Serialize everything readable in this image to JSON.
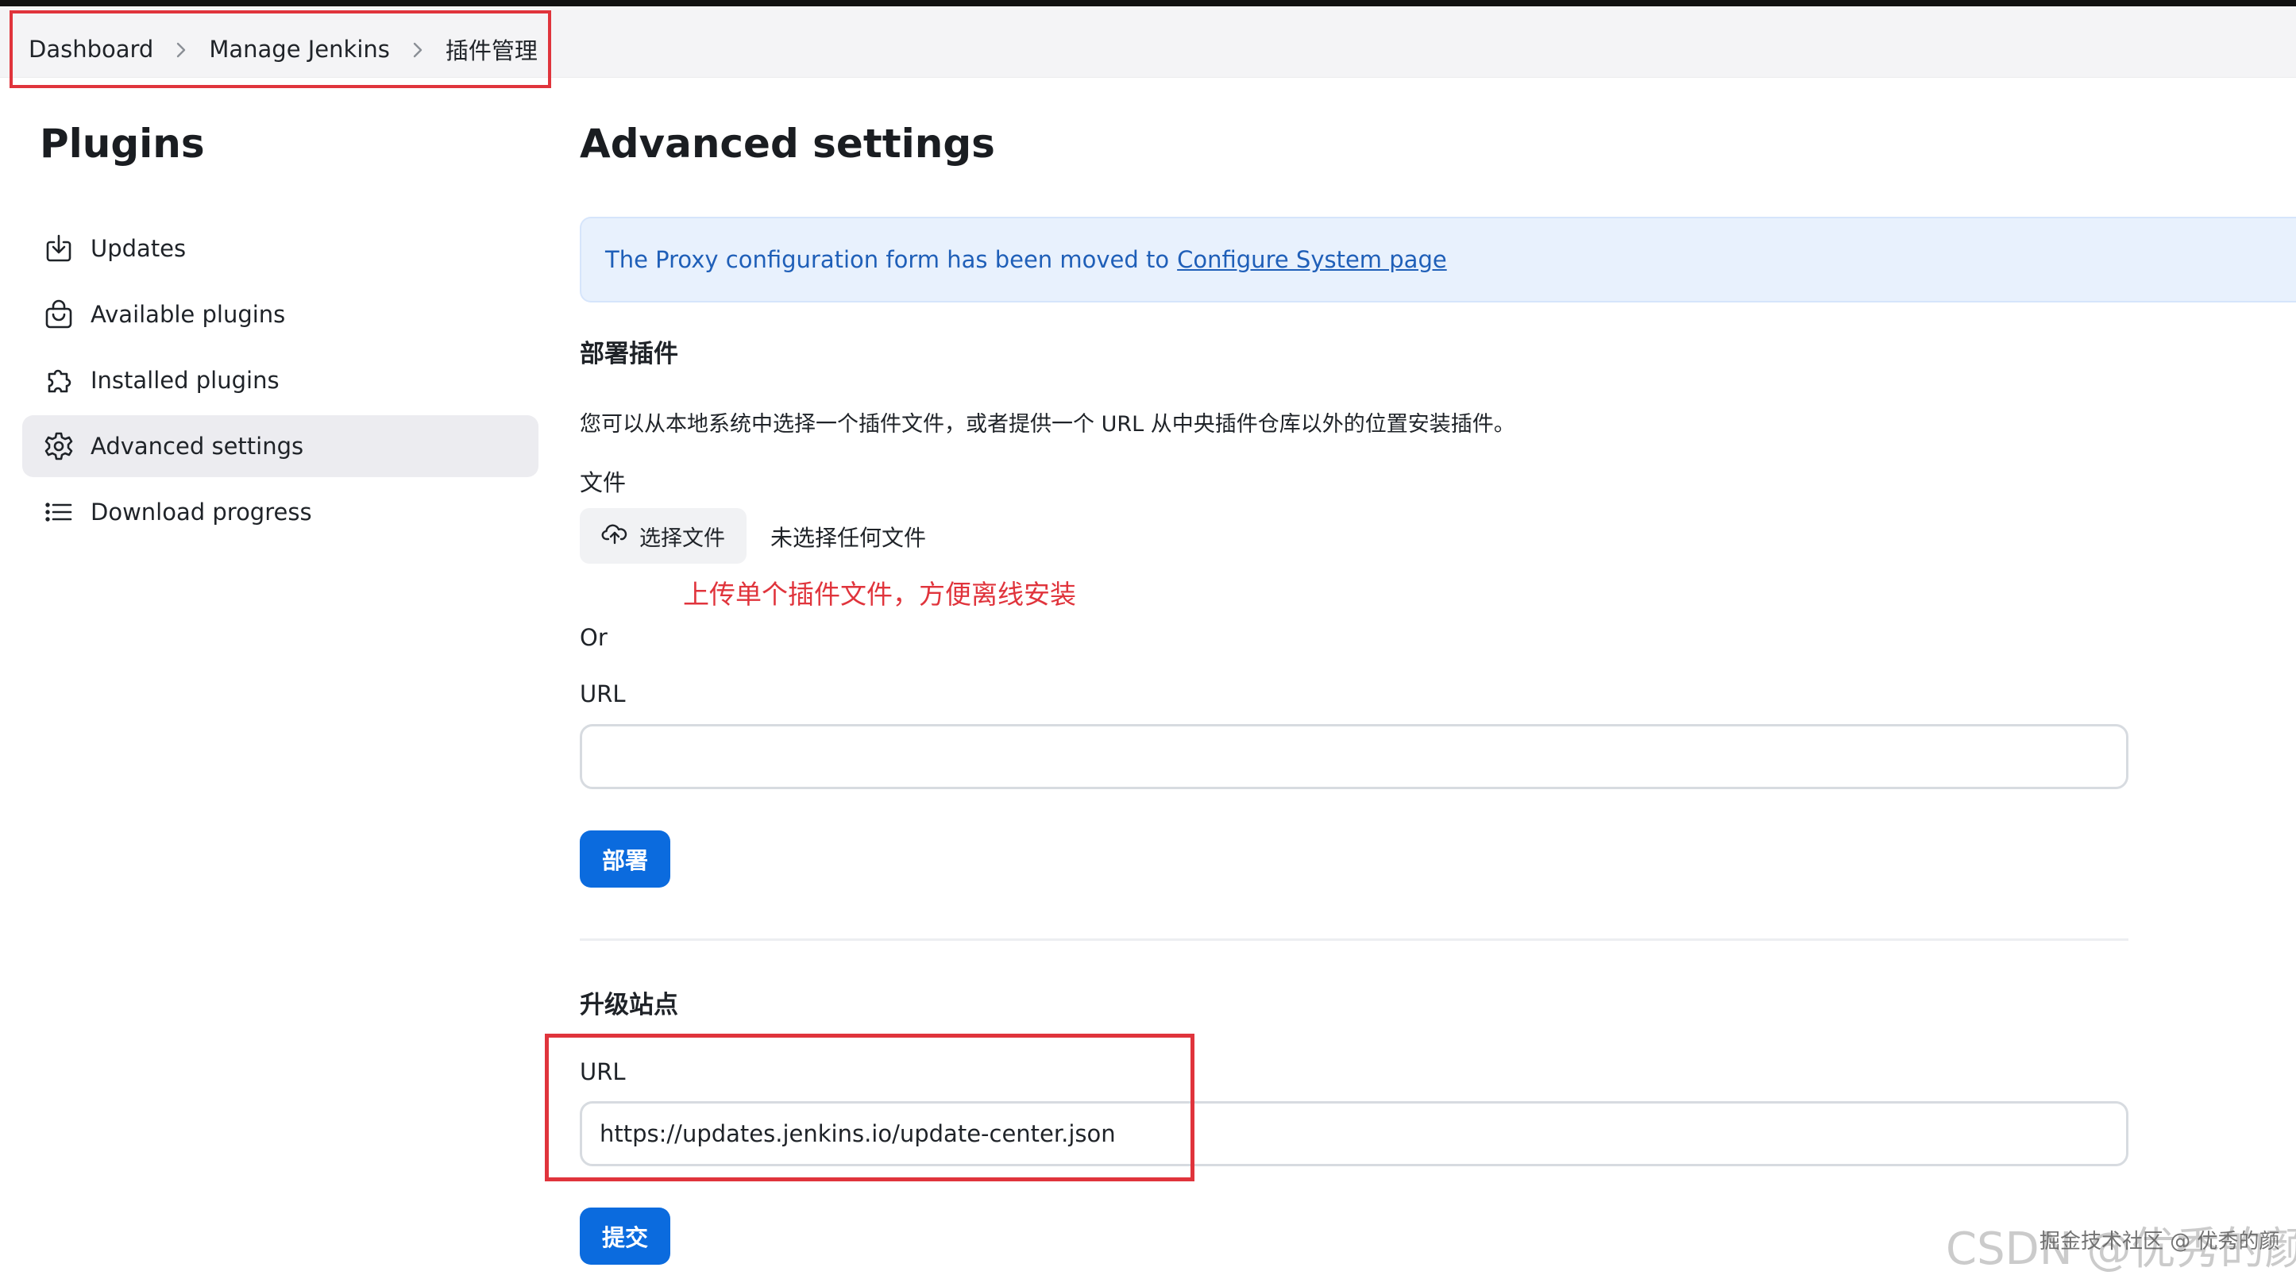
{
  "breadcrumb": {
    "items": [
      "Dashboard",
      "Manage Jenkins",
      "插件管理"
    ]
  },
  "sidebar": {
    "title": "Plugins",
    "items": [
      {
        "label": "Updates",
        "icon": "download-icon"
      },
      {
        "label": "Available plugins",
        "icon": "shopping-bag-icon"
      },
      {
        "label": "Installed plugins",
        "icon": "puzzle-icon"
      },
      {
        "label": "Advanced settings",
        "icon": "gear-icon",
        "active": true
      },
      {
        "label": "Download progress",
        "icon": "list-icon"
      }
    ]
  },
  "main": {
    "title": "Advanced settings",
    "notice": {
      "text": "The Proxy configuration form has been moved to",
      "link": "Configure System page",
      "color": "#1f5fb8"
    },
    "deploy": {
      "section_title": "部署插件",
      "description": "您可以从本地系统中选择一个插件文件，或者提供一个 URL 从中央插件仓库以外的位置安装插件。",
      "file_label": "文件",
      "choose_file_button": "选择文件",
      "no_file_text": "未选择任何文件",
      "annotation": "上传单个插件文件，方便离线安装",
      "or_text": "Or",
      "url_label": "URL",
      "url_value": "",
      "deploy_button": "部署"
    },
    "update_site": {
      "section_title": "升级站点",
      "url_label": "URL",
      "url_value": "https://updates.jenkins.io/update-center.json",
      "submit_button": "提交"
    }
  },
  "watermark": {
    "large": "CSDN @优秀的颜",
    "small": "掘金技术社区 @ 优秀的颜"
  },
  "colors": {
    "accent": "#0b6bde",
    "annotation_red": "#e0343c",
    "active_bg": "#ececf0"
  }
}
